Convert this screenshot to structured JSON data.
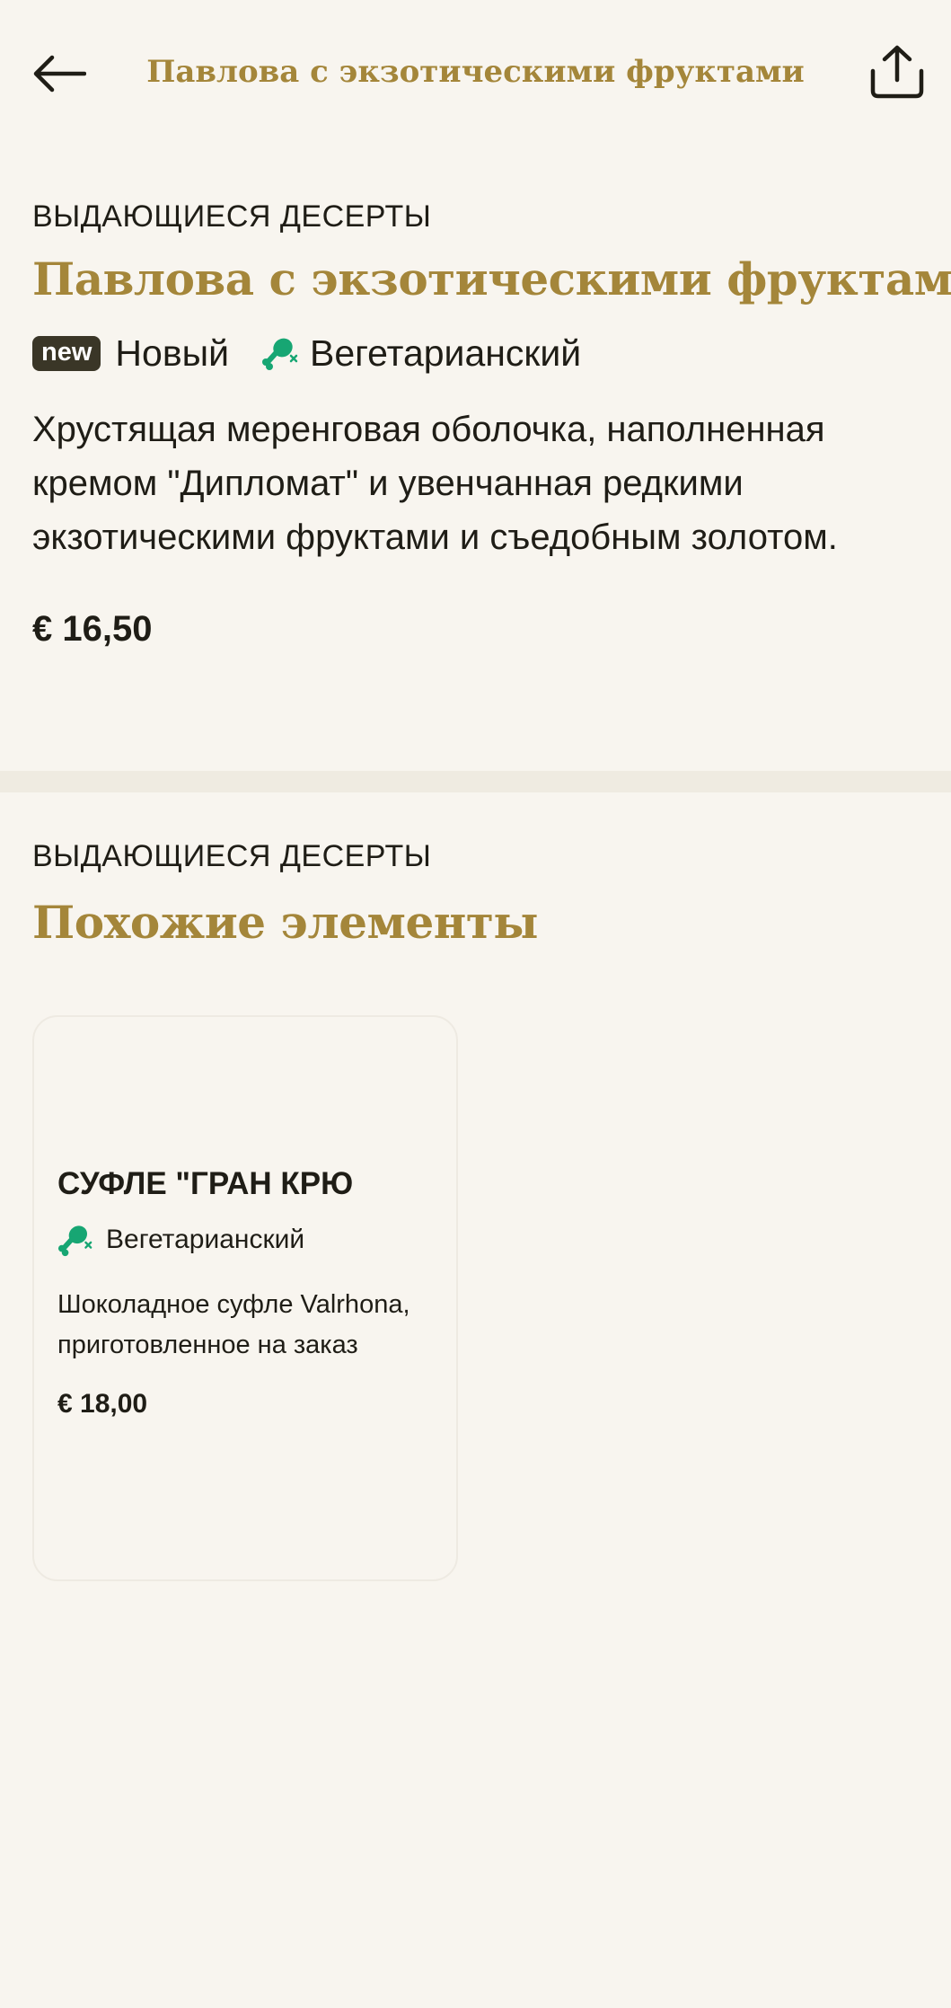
{
  "header": {
    "title": "Павлова с экзотическими фруктами",
    "back_icon": "arrow-left-icon",
    "share_icon": "share-icon"
  },
  "product": {
    "category": "ВЫДАЮЩИЕСЯ ДЕСЕРТЫ",
    "title": "Павлова с экзотическими фруктами",
    "badge": "new",
    "badge_label": "Новый",
    "diet_icon": "vegetarian-drumstick-icon",
    "diet_label": "Вегетарианский",
    "description": "Хрустящая меренговая оболочка, наполненная кремом \"Дипломат\" и увенчанная редкими экзотическими фруктами и съедобным золотом.",
    "price": "€ 16,50"
  },
  "similar": {
    "category": "ВЫДАЮЩИЕСЯ ДЕСЕРТЫ",
    "title": "Похожие элементы",
    "items": [
      {
        "title": "СУФЛЕ \"ГРАН КРЮ",
        "diet_label": "Вегетарианский",
        "description": "Шоколадное суфле Valrhona, приготовленное на заказ",
        "price": "€ 18,00"
      }
    ]
  },
  "colors": {
    "background": "#f8f5ef",
    "accent_gold": "#a4863a",
    "text": "#1f1d16",
    "veg_green": "#17a673",
    "badge_dark": "#3a3627"
  }
}
